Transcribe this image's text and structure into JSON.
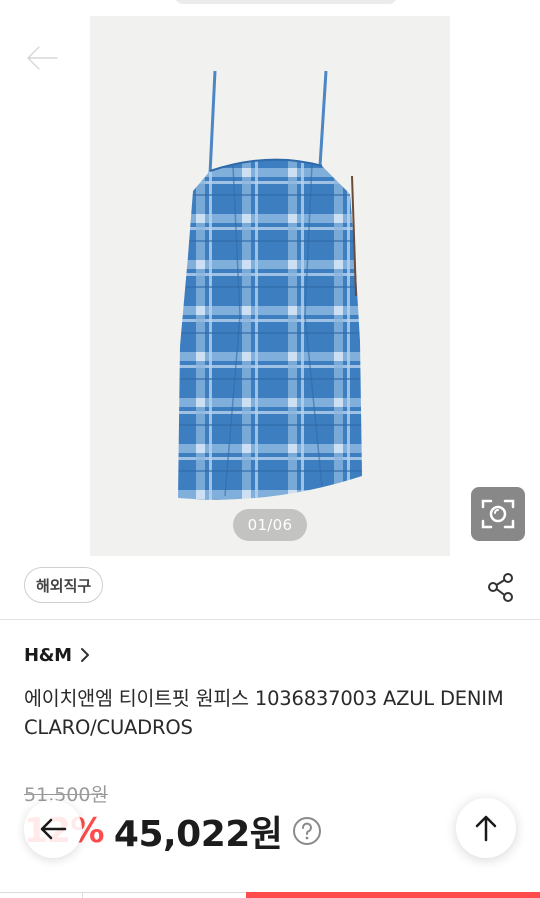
{
  "gallery": {
    "counter": "01/06",
    "icons": {
      "back": "arrow-left-icon",
      "lens": "image-search-icon"
    }
  },
  "tags": {
    "overseas_badge": "해외직구",
    "share_icon": "share-icon"
  },
  "product": {
    "brand": "H&M",
    "title": "에이치앤엠 티이트핏 원피스 1036837003 AZUL DENIM CLARO/CUADROS",
    "original_price": "51,500원",
    "discount": "12%",
    "sale_price": "45,022원"
  },
  "floating": {
    "back_icon": "arrow-left-icon",
    "top_icon": "arrow-up-icon",
    "help_icon": "question-circle-icon"
  },
  "colors": {
    "accent": "#ff4b4b",
    "denim": "#3f7fc0"
  }
}
